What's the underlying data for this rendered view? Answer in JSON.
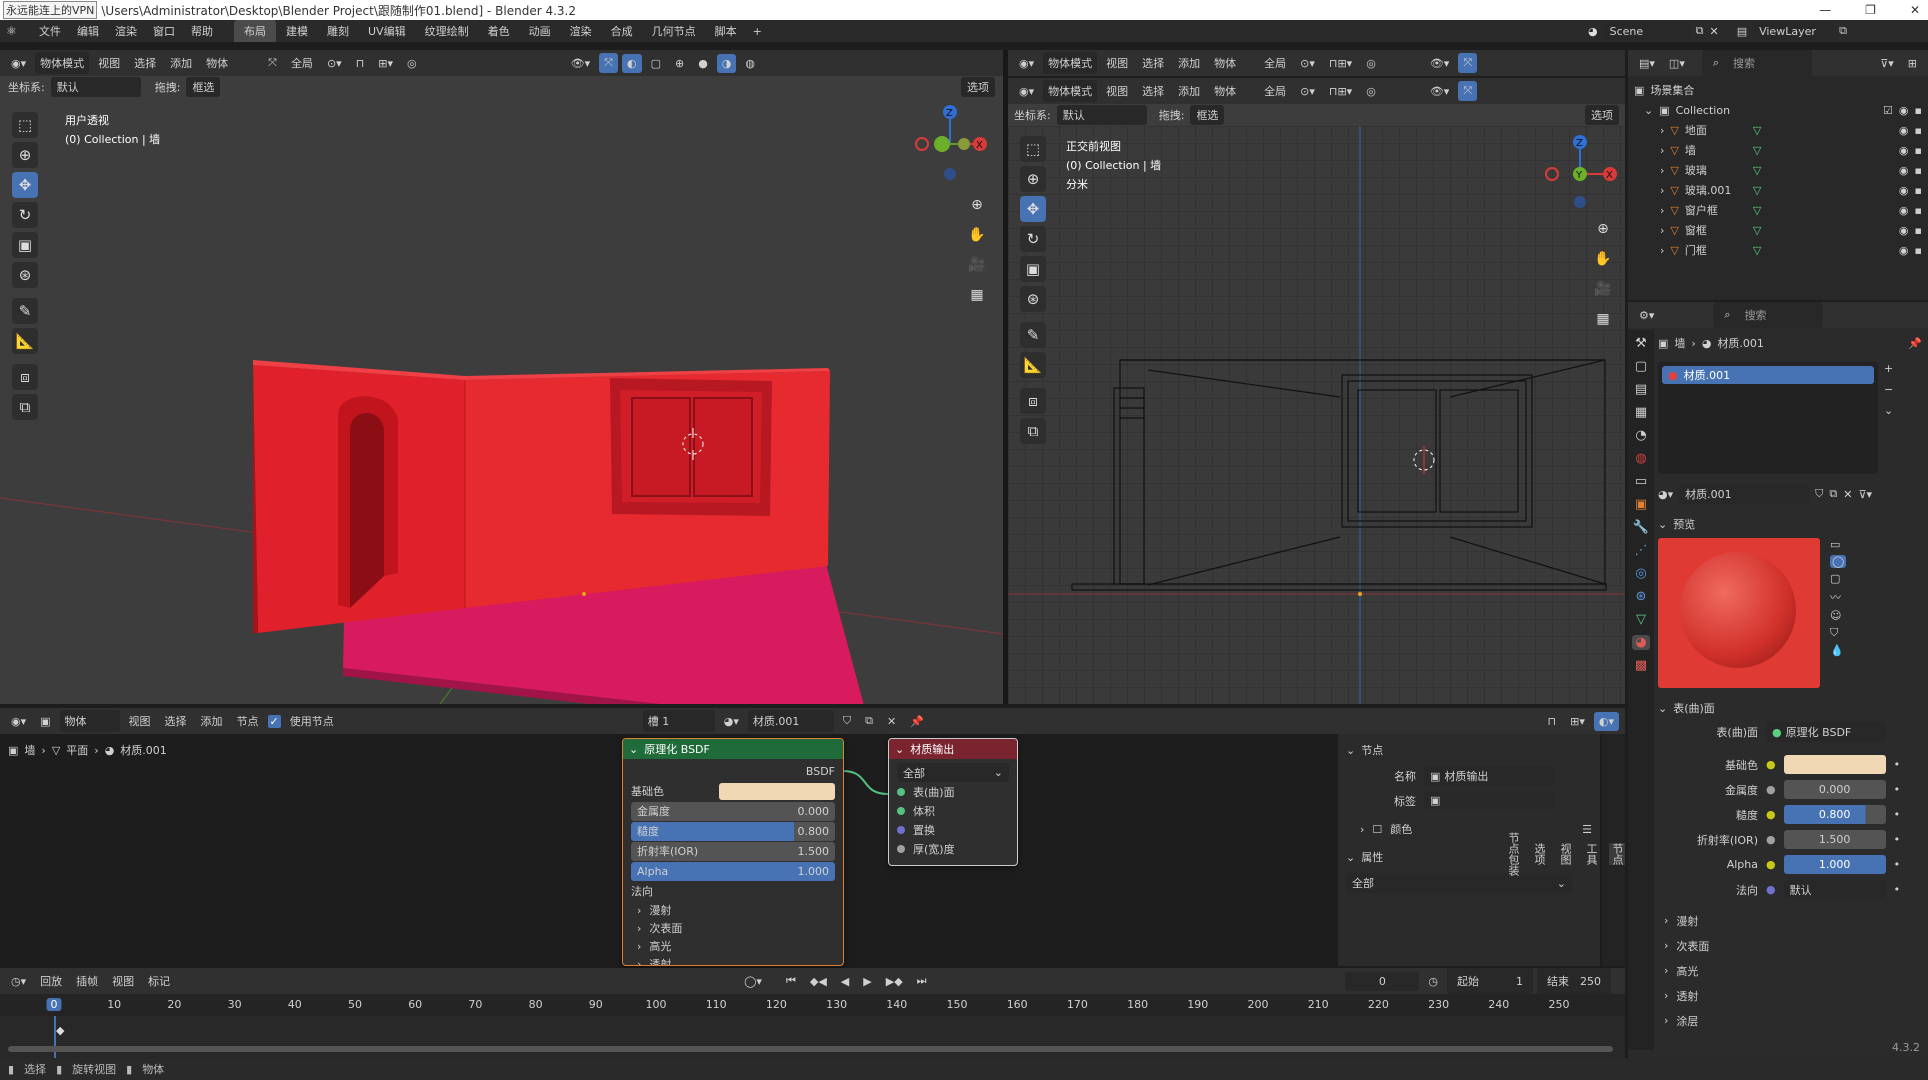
{
  "window": {
    "vpn_label": "永远能连上的VPN",
    "title": "\\Users\\Administrator\\Desktop\\Blender Project\\跟随制作01.blend] - Blender 4.3.2"
  },
  "menubar": {
    "file": "文件",
    "edit": "编辑",
    "render": "渲染",
    "window": "窗口",
    "help": "帮助",
    "workspaces": [
      "布局",
      "建模",
      "雕刻",
      "UV编辑",
      "纹理绘制",
      "着色",
      "动画",
      "渲染",
      "合成",
      "几何节点",
      "脚本"
    ],
    "scene": "Scene",
    "view_layer": "ViewLayer"
  },
  "viewport_left": {
    "mode": "物体模式",
    "menus": [
      "视图",
      "选择",
      "添加",
      "物体"
    ],
    "global": "全局",
    "coord_label": "坐标系:",
    "coord_value": "默认",
    "drag_label": "拖拽:",
    "drag_value": "框选",
    "options": "选项",
    "view_name": "用户透视",
    "collection_info": "(0) Collection | 墙"
  },
  "viewport_right": {
    "mode": "物体模式",
    "menus": [
      "视图",
      "选择",
      "添加",
      "物体"
    ],
    "global": "全局",
    "coord_label": "坐标系:",
    "coord_value": "默认",
    "drag_label": "拖拽:",
    "drag_value": "框选",
    "options": "选项",
    "view_name": "正交前视图",
    "collection_info": "(0) Collection | 墙",
    "unit": "分米"
  },
  "outliner": {
    "search_placeholder": "搜索",
    "root": "场景集合",
    "collection": "Collection",
    "items": [
      "地面",
      "墙",
      "玻璃",
      "玻璃.001",
      "窗户框",
      "窗框",
      "门框"
    ]
  },
  "properties": {
    "search_placeholder": "搜索",
    "breadcrumb_obj": "墙",
    "breadcrumb_mat": "材质.001",
    "slot_name": "材质.001",
    "material_name": "材质.001",
    "preview_label": "预览",
    "surface_section": "表(曲)面",
    "surface_label": "表(曲)面",
    "surface_value": "原理化 BSDF",
    "fields": [
      {
        "label": "基础色",
        "value": ""
      },
      {
        "label": "金属度",
        "value": "0.000"
      },
      {
        "label": "糙度",
        "value": "0.800"
      },
      {
        "label": "折射率(IOR)",
        "value": "1.500"
      },
      {
        "label": "Alpha",
        "value": "1.000"
      },
      {
        "label": "法向",
        "value": "默认"
      }
    ],
    "subsections": [
      "漫射",
      "次表面",
      "高光",
      "透射",
      "涂层"
    ],
    "version": "4.3.2"
  },
  "node_editor": {
    "type": "物体",
    "menus": [
      "视图",
      "选择",
      "添加",
      "节点"
    ],
    "use_nodes": "使用节点",
    "slot": "槽 1",
    "material": "材质.001",
    "breadcrumb": [
      "墙",
      "平面",
      "材质.001"
    ],
    "bsdf": {
      "title": "原理化 BSDF",
      "output": "BSDF",
      "base_color": "基础色",
      "metallic": {
        "label": "金属度",
        "value": "0.000"
      },
      "roughness": {
        "label": "糙度",
        "value": "0.800"
      },
      "ior": {
        "label": "折射率(IOR)",
        "value": "1.500"
      },
      "alpha": {
        "label": "Alpha",
        "value": "1.000"
      },
      "normal": "法向",
      "subs": [
        "漫射",
        "次表面",
        "高光",
        "透射"
      ]
    },
    "output": {
      "title": "材质输出",
      "target": "全部",
      "sockets": [
        "表(曲)面",
        "体积",
        "置换",
        "厚(宽)度"
      ]
    },
    "side_panel": {
      "node_section": "节点",
      "name_label": "名称",
      "name_value": "材质输出",
      "tag_label": "标签",
      "color_label": "颜色",
      "attr_section": "属性",
      "attr_value": "全部",
      "tabs": [
        "节点",
        "工具",
        "视图",
        "选项",
        "节点包装"
      ]
    }
  },
  "timeline": {
    "menus": [
      "回放",
      "插帧",
      "视图",
      "标记"
    ],
    "current": "0",
    "start_label": "起始",
    "start": "1",
    "end_label": "结束",
    "end": "250",
    "ticks": [
      "0",
      "10",
      "20",
      "30",
      "40",
      "50",
      "60",
      "70",
      "80",
      "90",
      "100",
      "110",
      "120",
      "130",
      "140",
      "150",
      "160",
      "170",
      "180",
      "190",
      "200",
      "210",
      "220",
      "230",
      "240",
      "250"
    ]
  },
  "statusbar": {
    "select": "选择",
    "rotate": "旋转视图",
    "object": "物体"
  },
  "colors": {
    "accent": "#4772b3",
    "wall": "#e0202a",
    "floor": "#d81a5e",
    "base_color": "#f0d8b4",
    "node_header_green": "#1f6b3a",
    "node_header_red": "#7a2430",
    "preview_red": "#e03a34"
  }
}
